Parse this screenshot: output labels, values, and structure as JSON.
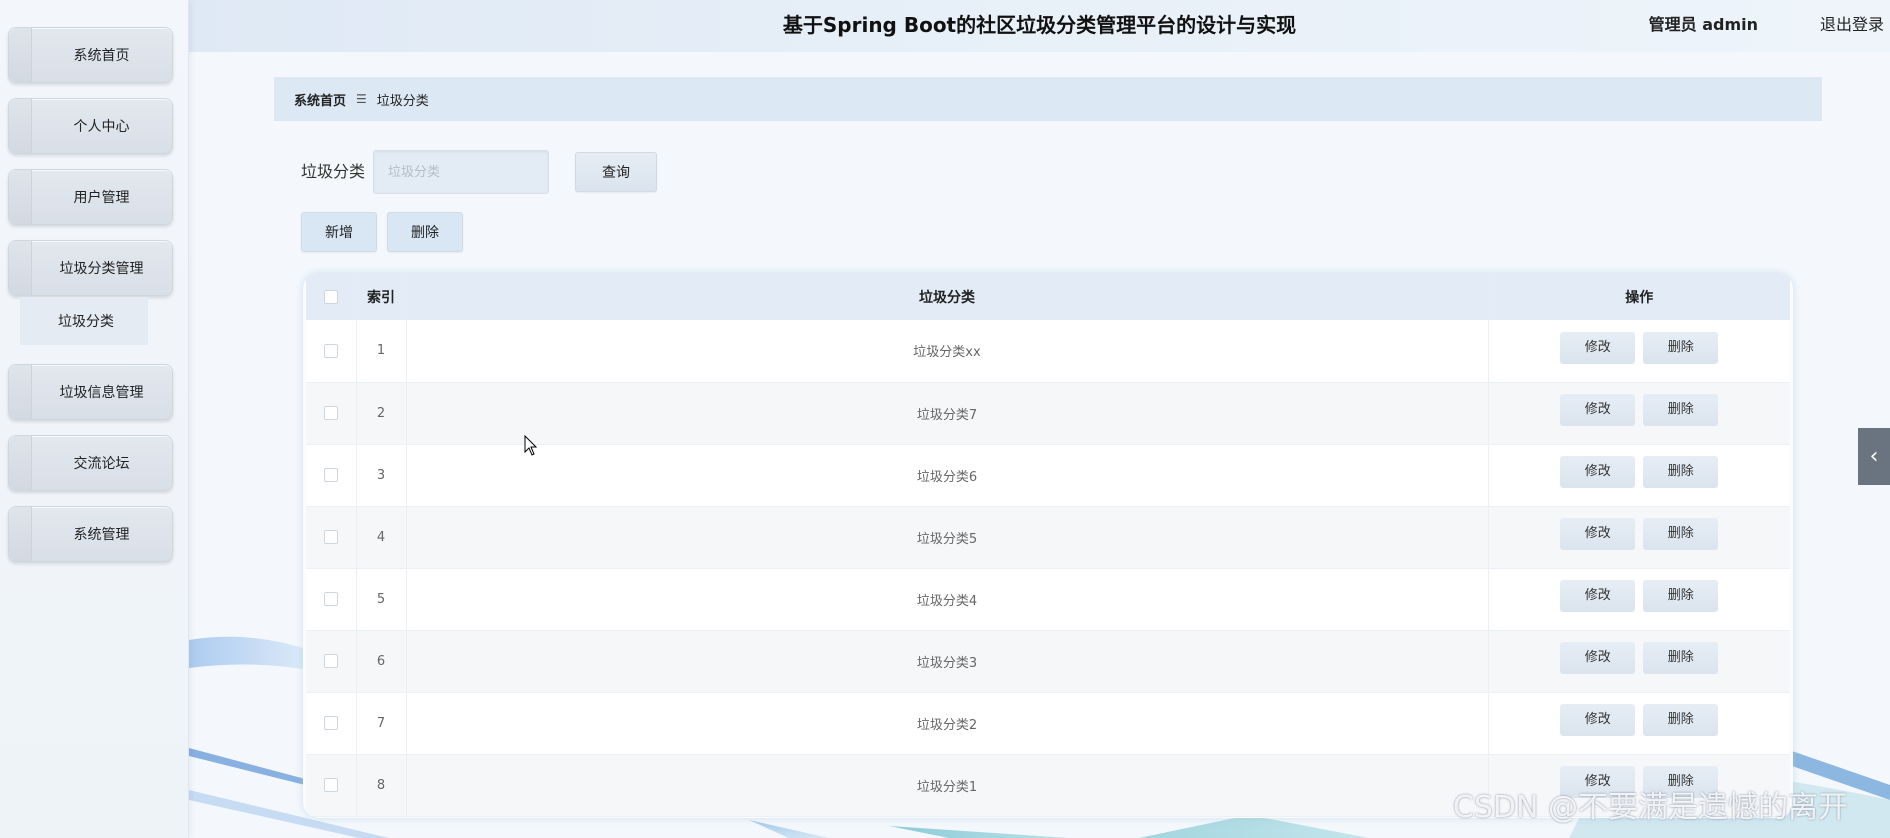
{
  "header": {
    "title": "基于Spring Boot的社区垃圾分类管理平台的设计与实现",
    "user": "管理员 admin",
    "logout": "退出登录"
  },
  "sidebar": {
    "items": [
      {
        "label": "系统首页"
      },
      {
        "label": "个人中心"
      },
      {
        "label": "用户管理"
      },
      {
        "label": "垃圾分类管理"
      },
      {
        "label": "垃圾信息管理"
      },
      {
        "label": "交流论坛"
      },
      {
        "label": "系统管理"
      }
    ],
    "submenu": {
      "label": "垃圾分类"
    }
  },
  "breadcrumb": {
    "home": "系统首页",
    "separator": "☰",
    "current": "垃圾分类"
  },
  "search": {
    "label": "垃圾分类",
    "placeholder": "垃圾分类",
    "query_button": "查询"
  },
  "actions": {
    "add": "新增",
    "delete": "删除"
  },
  "table": {
    "columns": [
      "索引",
      "垃圾分类",
      "操作"
    ],
    "rows": [
      {
        "index": "1",
        "name": "垃圾分类xx",
        "edit": "修改",
        "delete": "删除"
      },
      {
        "index": "2",
        "name": "垃圾分类7",
        "edit": "修改",
        "delete": "删除"
      },
      {
        "index": "3",
        "name": "垃圾分类6",
        "edit": "修改",
        "delete": "删除"
      },
      {
        "index": "4",
        "name": "垃圾分类5",
        "edit": "修改",
        "delete": "删除"
      },
      {
        "index": "5",
        "name": "垃圾分类4",
        "edit": "修改",
        "delete": "删除"
      },
      {
        "index": "6",
        "name": "垃圾分类3",
        "edit": "修改",
        "delete": "删除"
      },
      {
        "index": "7",
        "name": "垃圾分类2",
        "edit": "修改",
        "delete": "删除"
      },
      {
        "index": "8",
        "name": "垃圾分类1",
        "edit": "修改",
        "delete": "删除"
      }
    ]
  },
  "edge_tab": {
    "icon": "chevron-left-icon",
    "glyph": "‹"
  },
  "watermark": "CSDN @不要满是遗憾的离开",
  "colors": {
    "header_bg": "#dfe9f5",
    "breadcrumb_bg": "#dde8f5",
    "button_bg": "#dbe4ee",
    "table_header_bg": "#e2ebf6"
  }
}
